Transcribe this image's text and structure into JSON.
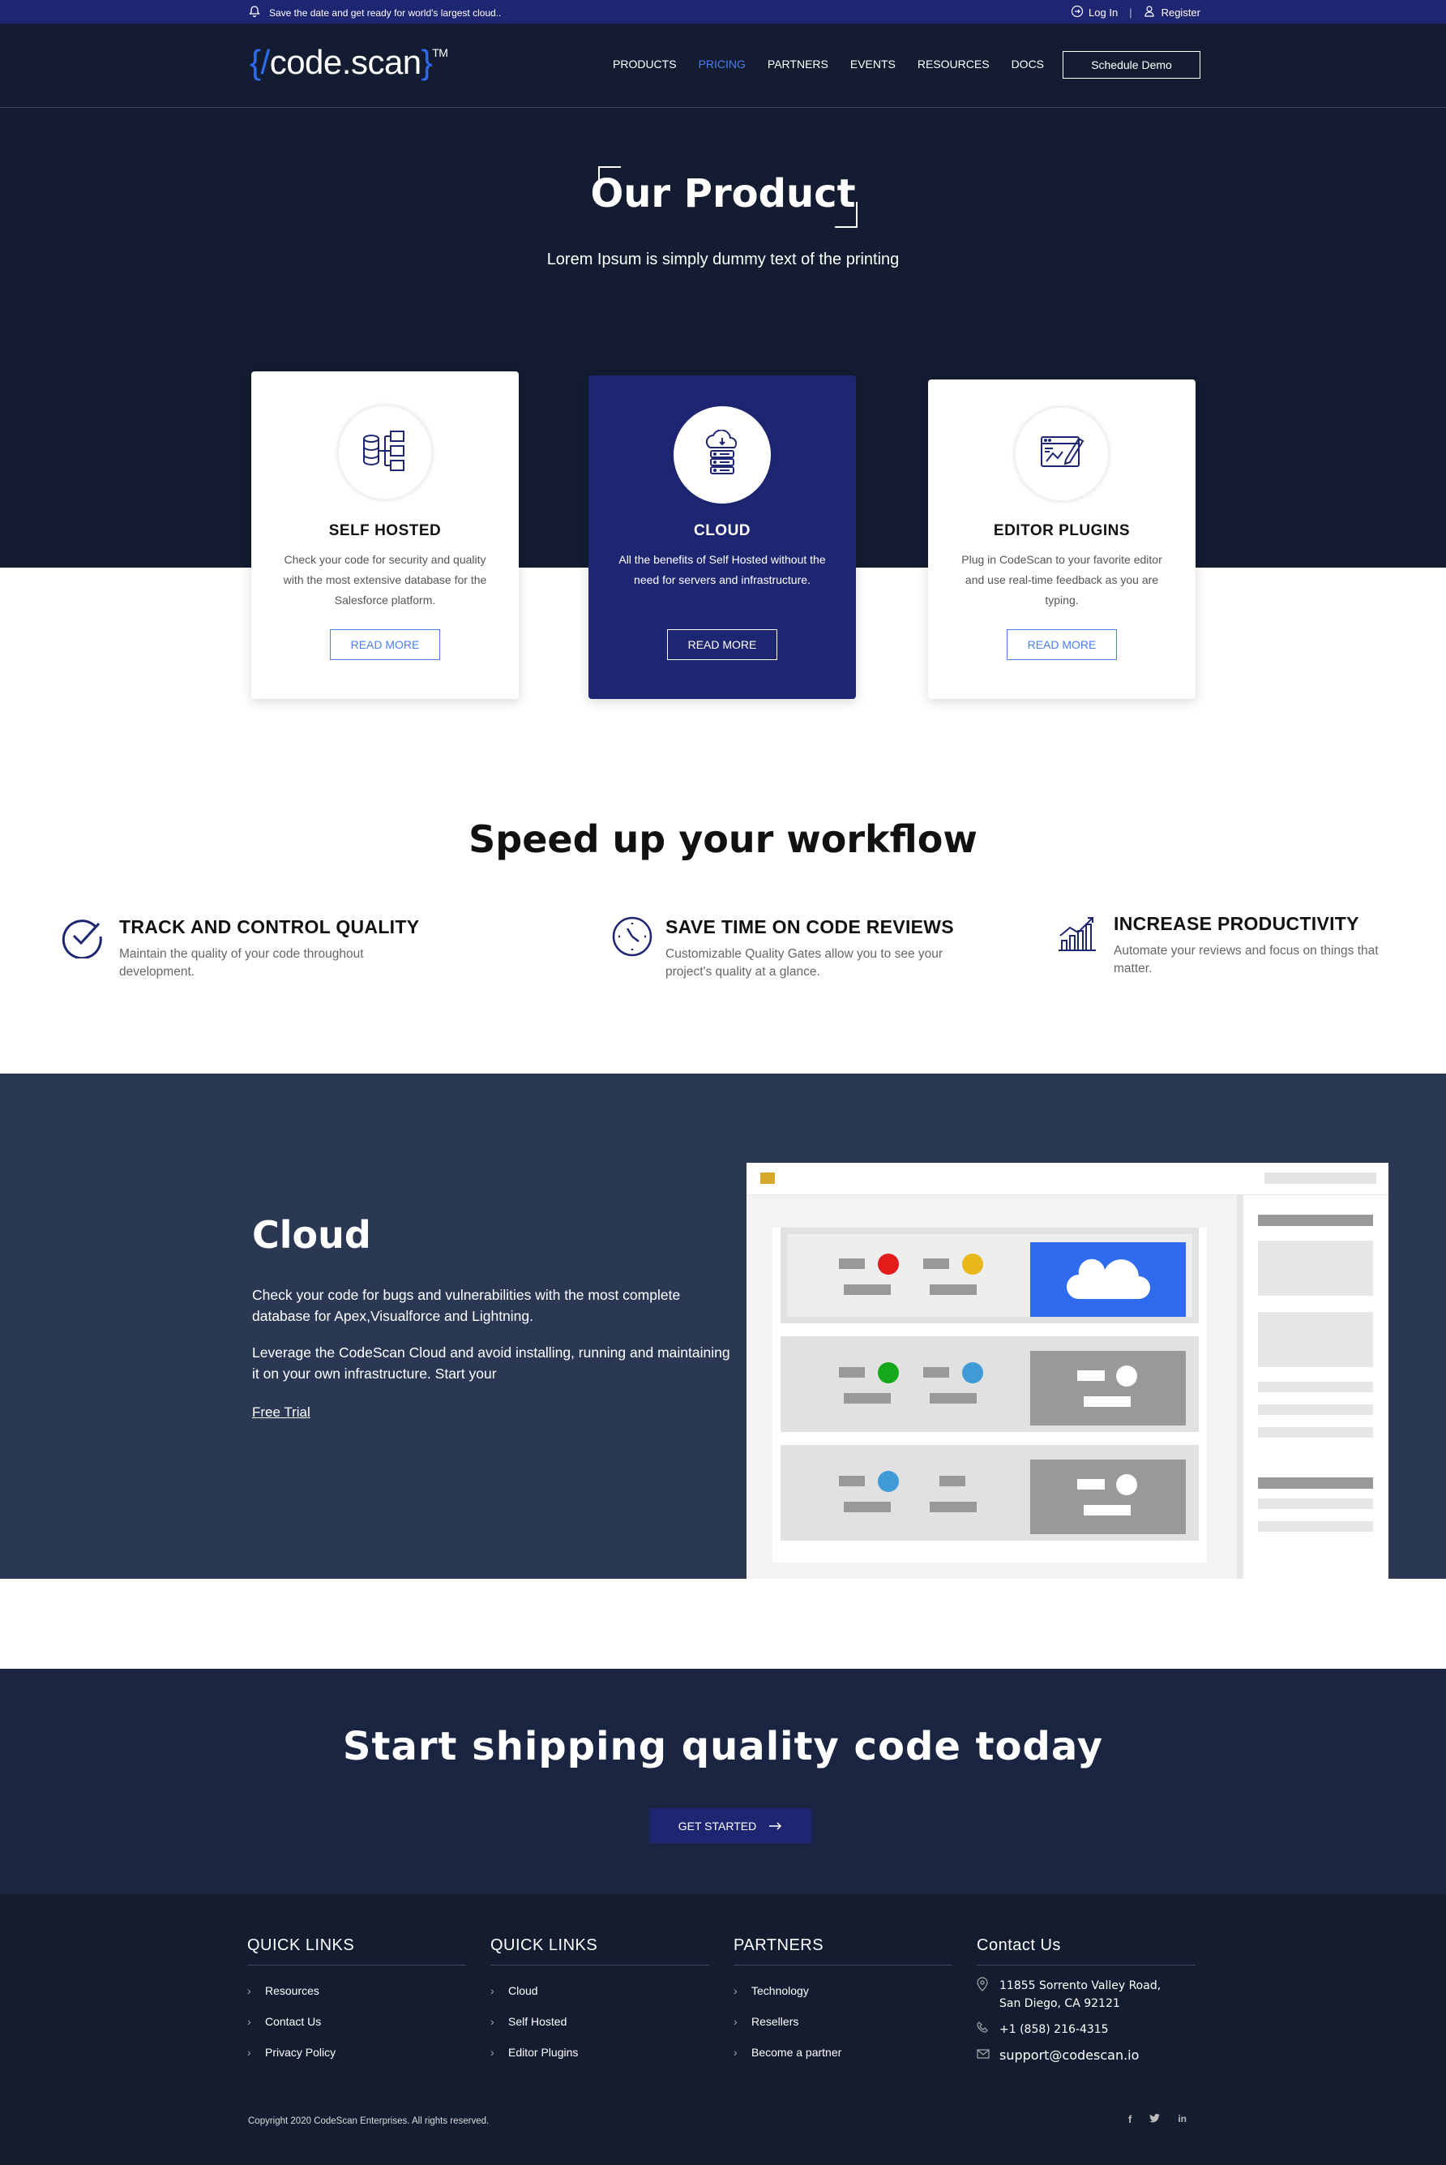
{
  "announcement": {
    "text": "Save the date and get ready for world's largest cloud..",
    "login": "Log In",
    "separator": "|",
    "register": "Register"
  },
  "header": {
    "logo": {
      "open": "{/",
      "name": "code.scan",
      "close": "}",
      "tm": "TM"
    },
    "nav": [
      {
        "label": "PRODUCTS"
      },
      {
        "label": "PRICING",
        "active": true
      },
      {
        "label": "PARTNERS"
      },
      {
        "label": "EVENTS"
      },
      {
        "label": "RESOURCES"
      },
      {
        "label": "DOCS"
      }
    ],
    "cta": "Schedule Demo"
  },
  "hero": {
    "title": "Our Product",
    "subtitle": "Lorem Ipsum is simply dummy text of the printing"
  },
  "products": [
    {
      "icon": "database-icon",
      "title": "SELF HOSTED",
      "text": "Check your code for security and quality with the most extensive database for the Salesforce platform.",
      "button": "READ MORE"
    },
    {
      "icon": "cloud-server-icon",
      "title": "CLOUD",
      "text": "All the benefits of Self Hosted without the need for servers and infrastructure.",
      "button": "READ MORE",
      "featured": true
    },
    {
      "icon": "editor-plugin-icon",
      "title": "EDITOR PLUGINS",
      "text": "Plug in CodeScan to your favorite editor and use real-time feedback as you are typing.",
      "button": "READ MORE"
    }
  ],
  "workflow": {
    "title": "Speed up your workflow",
    "features": [
      {
        "icon": "check-circle-icon",
        "title": "TRACK AND CONTROL QUALITY",
        "text": "Maintain the quality of your code throughout development."
      },
      {
        "icon": "clock-icon",
        "title": "SAVE TIME ON CODE REVIEWS",
        "text": "Customizable Quality Gates allow you to see your project's quality at a glance."
      },
      {
        "icon": "growth-chart-icon",
        "title": "INCREASE PRODUCTIVITY",
        "text": "Automate your reviews and focus on things that matter."
      }
    ]
  },
  "cloud": {
    "title": "Cloud",
    "p1": "Check your code for bugs and vulnerabilities with the most complete database for Apex,Visualforce and Lightning.",
    "p2": "Leverage the CodeScan Cloud and avoid installing, running and maintaining it on your own infrastructure. Start your",
    "link": "Free Trial",
    "colors": {
      "red": "#e31b1b",
      "yellow": "#e8b81a",
      "green": "#16a81b",
      "blue": "#3f9ad8",
      "accent": "#2f6bef"
    }
  },
  "cta": {
    "title": "Start shipping quality code today",
    "button": "GET STARTED"
  },
  "footer": {
    "columns": [
      {
        "title": "QUICK LINKS",
        "links": [
          "Resources",
          "Contact Us",
          "Privacy Policy"
        ]
      },
      {
        "title": "QUICK LINKS",
        "links": [
          "Cloud",
          "Self Hosted",
          "Editor Plugins"
        ]
      },
      {
        "title": "PARTNERS",
        "links": [
          "Technology",
          "Resellers",
          "Become a partner"
        ]
      }
    ],
    "contact": {
      "title": "Contact Us",
      "address_line1": "11855 Sorrento Valley Road,",
      "address_line2": "San Diego, CA 92121",
      "phone": "+1 (858) 216-4315",
      "email": "support@codescan.io"
    },
    "copyright": "Copyright 2020 CodeScan Enterprises. All rights reserved.",
    "social": [
      "facebook-icon",
      "twitter-icon",
      "linkedin-icon"
    ]
  }
}
